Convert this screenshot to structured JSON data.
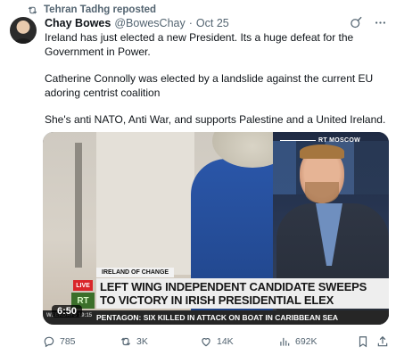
{
  "repost": {
    "icon": "repost-icon",
    "text": "Tehran Tadhg reposted"
  },
  "tweet": {
    "author_name": "Chay Bowes",
    "handle": "@BowesChay",
    "separator": "·",
    "date": "Oct 25",
    "paragraphs": [
      "Ireland has just elected a new President. Its a huge defeat for the Government in Power.",
      "Catherine Connolly was elected by a landslide against the current EU adoring centrist coalition",
      "She's anti NATO, Anti War, and supports Palestine and a United Ireland."
    ]
  },
  "media": {
    "channel_label": "RT MOSCOW",
    "tag": "IRELAND OF CHANGE",
    "live": "LIVE",
    "logo_text": "RT",
    "headline_line1": "LEFT WING INDEPENDENT CANDIDATE SWEEPS",
    "headline_line2": "TO VICTORY IN IRISH PRESIDENTIAL ELEX",
    "ticker_time": "WEEKDAYS 19:15",
    "ticker": "PENTAGON: SIX KILLED IN ATTACK ON BOAT IN CARIBBEAN SEA",
    "duration": "6:50",
    "headline_bar_color": "#eeeeee",
    "live_color": "#d9262a"
  },
  "actions": {
    "replies": "785",
    "reposts": "3K",
    "likes": "14K",
    "views": "692K"
  },
  "colors": {
    "text": "#0f1419",
    "muted": "#536471"
  }
}
